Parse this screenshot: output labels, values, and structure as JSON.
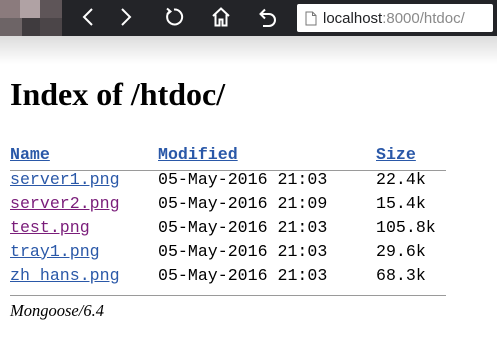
{
  "browser": {
    "url_host": "localhost",
    "url_path": ":8000/htdoc/",
    "icons": [
      "back-icon",
      "forward-icon",
      "reload-icon",
      "home-icon",
      "undo-icon",
      "page-icon"
    ]
  },
  "page": {
    "heading": "Index of /htdoc/",
    "columns": {
      "name": "Name",
      "modified": "Modified",
      "size": "Size"
    },
    "files": [
      {
        "name": "server1.png",
        "modified": "05-May-2016 21:03",
        "size": "22.4k",
        "visited": false
      },
      {
        "name": "server2.png",
        "modified": "05-May-2016 21:09",
        "size": "15.4k",
        "visited": true
      },
      {
        "name": "test.png",
        "modified": "05-May-2016 21:03",
        "size": "105.8k",
        "visited": true
      },
      {
        "name": "tray1.png",
        "modified": "05-May-2016 21:03",
        "size": "29.6k",
        "visited": false
      },
      {
        "name": "zh_hans.png",
        "modified": "05-May-2016 21:03",
        "size": "68.3k",
        "visited": false
      }
    ],
    "footer": "Mongoose/6.4"
  },
  "colors": {
    "link": "#2a58a8",
    "visited_link": "#7a1d7a",
    "toolbar": "#232428"
  }
}
